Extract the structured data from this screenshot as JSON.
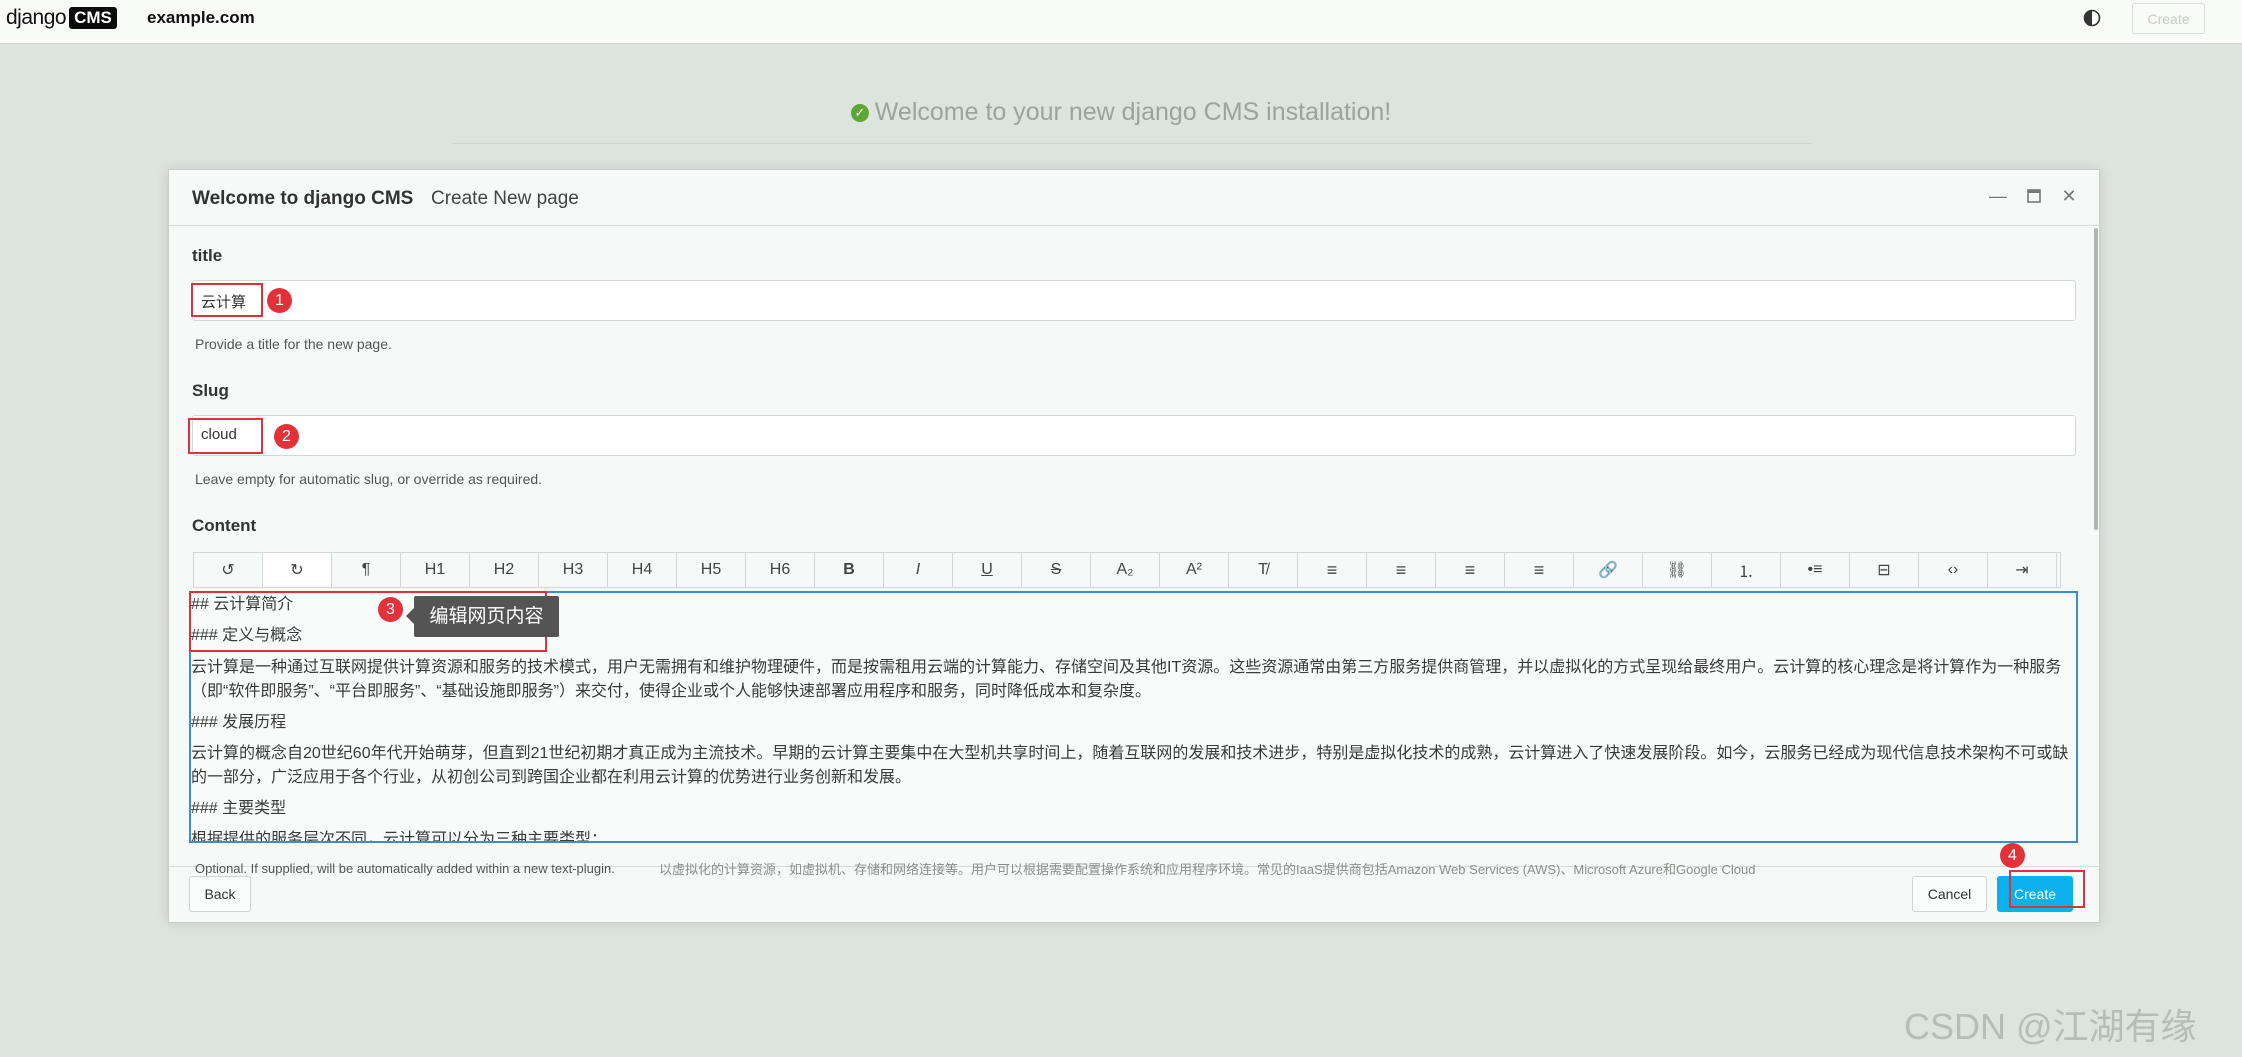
{
  "topbar": {
    "logo_text": "django",
    "logo_badge": "CMS",
    "site_name": "example.com",
    "contrast_icon": "half-circle-contrast-icon",
    "create_label": "Create"
  },
  "welcome": {
    "message": "Welcome to your new django CMS installation!"
  },
  "modal": {
    "title": "Welcome to django CMS",
    "subtitle": "Create New page",
    "minimize_icon": "minimize-icon",
    "maximize_icon": "maximize-icon",
    "close_icon": "close-icon",
    "title_field": {
      "label": "title",
      "value": "云计算",
      "help": "Provide a title for the new page."
    },
    "slug_field": {
      "label": "Slug",
      "value": "cloud",
      "help": "Leave empty for automatic slug, or override as required."
    },
    "content_field": {
      "label": "Content",
      "toolbar": [
        {
          "name": "undo",
          "glyph": "↺"
        },
        {
          "name": "redo",
          "glyph": "↻"
        },
        {
          "name": "paragraph",
          "glyph": "¶"
        },
        {
          "name": "h1",
          "glyph": "H1"
        },
        {
          "name": "h2",
          "glyph": "H2"
        },
        {
          "name": "h3",
          "glyph": "H3"
        },
        {
          "name": "h4",
          "glyph": "H4"
        },
        {
          "name": "h5",
          "glyph": "H5"
        },
        {
          "name": "h6",
          "glyph": "H6"
        },
        {
          "name": "bold",
          "glyph": "B"
        },
        {
          "name": "italic",
          "glyph": "I"
        },
        {
          "name": "underline",
          "glyph": "U"
        },
        {
          "name": "strikethrough",
          "glyph": "S"
        },
        {
          "name": "subscript",
          "glyph": "A₂"
        },
        {
          "name": "superscript",
          "glyph": "A²"
        },
        {
          "name": "clear-format",
          "glyph": "T̸"
        },
        {
          "name": "align-left",
          "glyph": "≡"
        },
        {
          "name": "align-center",
          "glyph": "≡"
        },
        {
          "name": "align-right",
          "glyph": "≡"
        },
        {
          "name": "justify",
          "glyph": "≡"
        },
        {
          "name": "link",
          "glyph": "🔗"
        },
        {
          "name": "unlink",
          "glyph": "⛓"
        },
        {
          "name": "ordered-list",
          "glyph": "⒈"
        },
        {
          "name": "bullet-list",
          "glyph": "•≡"
        },
        {
          "name": "horizontal-rule",
          "glyph": "⊟"
        },
        {
          "name": "source-code",
          "glyph": "‹›"
        },
        {
          "name": "indent",
          "glyph": "⇥"
        }
      ],
      "lines": [
        "## 云计算简介",
        "### 定义与概念",
        "云计算是一种通过互联网提供计算资源和服务的技术模式，用户无需拥有和维护物理硬件，而是按需租用云端的计算能力、存储空间及其他IT资源。这些资源通常由第三方服务提供商管理，并以虚拟化的方式呈现给最终用户。云计算的核心理念是将计算作为一种服务（即“软件即服务”、“平台即服务”、“基础设施即服务”）来交付，使得企业或个人能够快速部署应用程序和服务，同时降低成本和复杂度。",
        "### 发展历程",
        "云计算的概念自20世纪60年代开始萌芽，但直到21世纪初期才真正成为主流技术。早期的云计算主要集中在大型机共享时间上，随着互联网的发展和技术进步，特别是虚拟化技术的成熟，云计算进入了快速发展阶段。如今，云服务已经成为现代信息技术架构不可或缺的一部分，广泛应用于各个行业，从初创公司到跨国企业都在利用云计算的优势进行业务创新和发展。",
        "### 主要类型",
        "根据提供的服务层次不同，云计算可以分为三种主要类型："
      ],
      "footer_hint": "Optional. If supplied, will be automatically added within a new text-plugin.",
      "overflow_text": "以虚拟化的计算资源，如虚拟机、存储和网络连接等。用户可以根据需要配置操作系统和应用程序环境。常见的IaaS提供商包括Amazon Web Services (AWS)、Microsoft Azure和Google Cloud"
    },
    "tooltip": "编辑网页内容",
    "badges": [
      "1",
      "2",
      "3",
      "4"
    ],
    "back_label": "Back",
    "cancel_label": "Cancel",
    "create_label": "Create"
  },
  "watermark": "CSDN @江湖有缘"
}
